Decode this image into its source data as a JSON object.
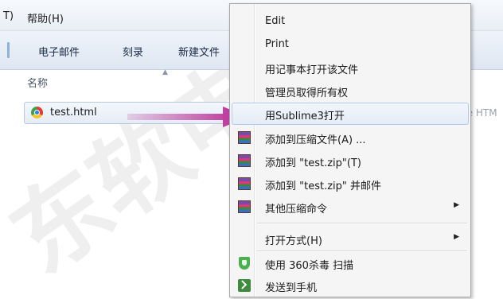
{
  "menubar": {
    "items": [
      "T)",
      "帮助(H)"
    ]
  },
  "toolbar": {
    "items": [
      "电子邮件",
      "刻录",
      "新建文件"
    ]
  },
  "columns": {
    "name_header": "名称",
    "type_partial": "me HTM"
  },
  "file": {
    "name": "test.html",
    "icon": "chrome-icon"
  },
  "context_menu": {
    "items": [
      {
        "label": "Edit"
      },
      {
        "label": "Print"
      },
      {
        "label": "用记事本打开该文件"
      },
      {
        "label": "管理员取得所有权"
      },
      {
        "label": "用Sublime3打开",
        "highlighted": true
      },
      {
        "label": "添加到压缩文件(A) ...",
        "icon": "winrar-icon"
      },
      {
        "label": "添加到 \"test.zip\"(T)",
        "icon": "winrar-icon"
      },
      {
        "label": "添加到 \"test.zip\" 并邮件",
        "icon": "winrar-icon"
      },
      {
        "label": "其他压缩命令",
        "icon": "winrar-icon",
        "submenu": true
      },
      {
        "label": "打开方式(H)",
        "submenu": true
      },
      {
        "label": "使用 360杀毒 扫描",
        "icon": "shield-icon"
      },
      {
        "label": "发送到手机",
        "icon": "phone-send-icon"
      }
    ]
  },
  "watermark": "东软电子"
}
